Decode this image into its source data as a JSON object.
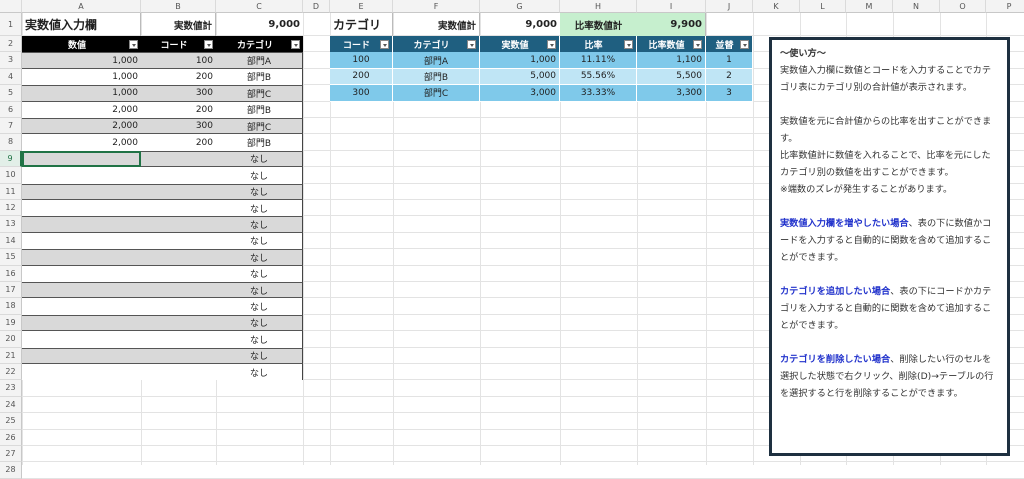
{
  "columns": [
    "A",
    "B",
    "C",
    "D",
    "E",
    "F",
    "G",
    "H",
    "I",
    "J",
    "K",
    "L",
    "M",
    "N",
    "O",
    "P"
  ],
  "selected_row": 9,
  "input_table": {
    "title": "実数値入力欄",
    "total_label": "実数値計",
    "total_value": "9,000",
    "headers": [
      "数値",
      "コード",
      "カテゴリ"
    ],
    "rows": [
      [
        "1,000",
        "100",
        "部門A"
      ],
      [
        "1,000",
        "200",
        "部門B"
      ],
      [
        "1,000",
        "300",
        "部門C"
      ],
      [
        "2,000",
        "200",
        "部門B"
      ],
      [
        "2,000",
        "300",
        "部門C"
      ],
      [
        "2,000",
        "200",
        "部門B"
      ],
      [
        "",
        "",
        "なし"
      ],
      [
        "",
        "",
        "なし"
      ],
      [
        "",
        "",
        "なし"
      ],
      [
        "",
        "",
        "なし"
      ],
      [
        "",
        "",
        "なし"
      ],
      [
        "",
        "",
        "なし"
      ],
      [
        "",
        "",
        "なし"
      ],
      [
        "",
        "",
        "なし"
      ],
      [
        "",
        "",
        "なし"
      ],
      [
        "",
        "",
        "なし"
      ],
      [
        "",
        "",
        "なし"
      ],
      [
        "",
        "",
        "なし"
      ],
      [
        "",
        "",
        "なし"
      ],
      [
        "",
        "",
        "なし"
      ]
    ]
  },
  "category_table": {
    "title": "カテゴリ",
    "total_label": "実数値計",
    "total_value": "9,000",
    "ratio_total_label": "比率数値計",
    "ratio_total_value": "9,900",
    "headers": [
      "コード",
      "カテゴリ",
      "実数値",
      "比率",
      "比率数値",
      "並替"
    ],
    "rows": [
      [
        "100",
        "部門A",
        "1,000",
        "11.11%",
        "1,100",
        "1"
      ],
      [
        "200",
        "部門B",
        "5,000",
        "55.56%",
        "5,500",
        "2"
      ],
      [
        "300",
        "部門C",
        "3,000",
        "33.33%",
        "3,300",
        "3"
      ]
    ]
  },
  "colors": {
    "input_header": "#000000",
    "input_band": "#d9d9d9",
    "cat_header": "#1f5f80",
    "cat_band1": "#7fc9ea",
    "cat_band2": "#bfe5f5",
    "ratio_total_bg": "#c6efce"
  },
  "note": {
    "title": "～使い方～",
    "p1": "実数値入力欄に数値とコードを入力することでカテゴリ表にカテゴリ別の合計値が表示されます。",
    "p2a": "実数値を元に合計値からの比率を出すことができます。",
    "p2b": "比率数値計に数値を入れることで、比率を元にしたカテゴリ別の数値を出すことができます。",
    "p2c": "※端数のズレが発生することがあります。",
    "p3_em": "実数値入力欄を増やしたい場合",
    "p3": "、表の下に数値かコードを入力すると自動的に関数を含めて追加することができます。",
    "p4_em": "カテゴリを追加したい場合",
    "p4": "、表の下にコードかカテゴリを入力すると自動的に関数を含めて追加することができます。",
    "p5_em": "カテゴリを削除したい場合",
    "p5": "、削除したい行のセルを選択した状態で右クリック、削除(D)→テーブルの行を選択すると行を削除することができます。"
  }
}
